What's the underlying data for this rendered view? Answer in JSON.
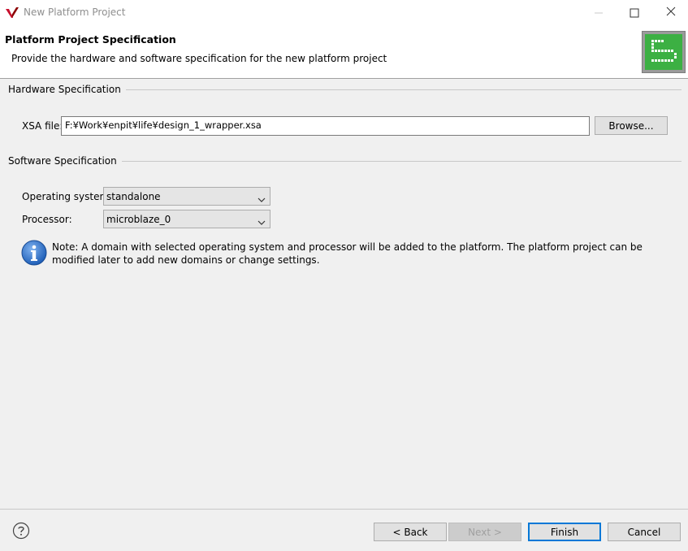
{
  "window": {
    "title": "New Platform Project"
  },
  "header": {
    "title": "Platform Project Specification",
    "description": "Provide the hardware and software specification for the new platform project"
  },
  "hardware": {
    "section_title": "Hardware Specification",
    "xsa_label": "XSA file:",
    "xsa_value": "F:¥Work¥enpit¥life¥design_1_wrapper.xsa",
    "browse_label": "Browse..."
  },
  "software": {
    "section_title": "Software Specification",
    "os_label": "Operating system:",
    "os_value": "standalone",
    "processor_label": "Processor:",
    "processor_value": "microblaze_0",
    "note": "Note: A domain with selected operating system and processor will be added to the platform. The platform project can be modified later to add new domains or change settings."
  },
  "footer": {
    "back_label": "< Back",
    "next_label": "Next >",
    "finish_label": "Finish",
    "cancel_label": "Cancel"
  },
  "icons": {
    "app": "vitis-logo-icon",
    "banner": "platform-wizard-icon",
    "info": "info-icon",
    "help": "help-icon"
  },
  "colors": {
    "accent": "#0078d7",
    "banner_green": "#3cb043",
    "info_blue": "#1f5fb8"
  }
}
